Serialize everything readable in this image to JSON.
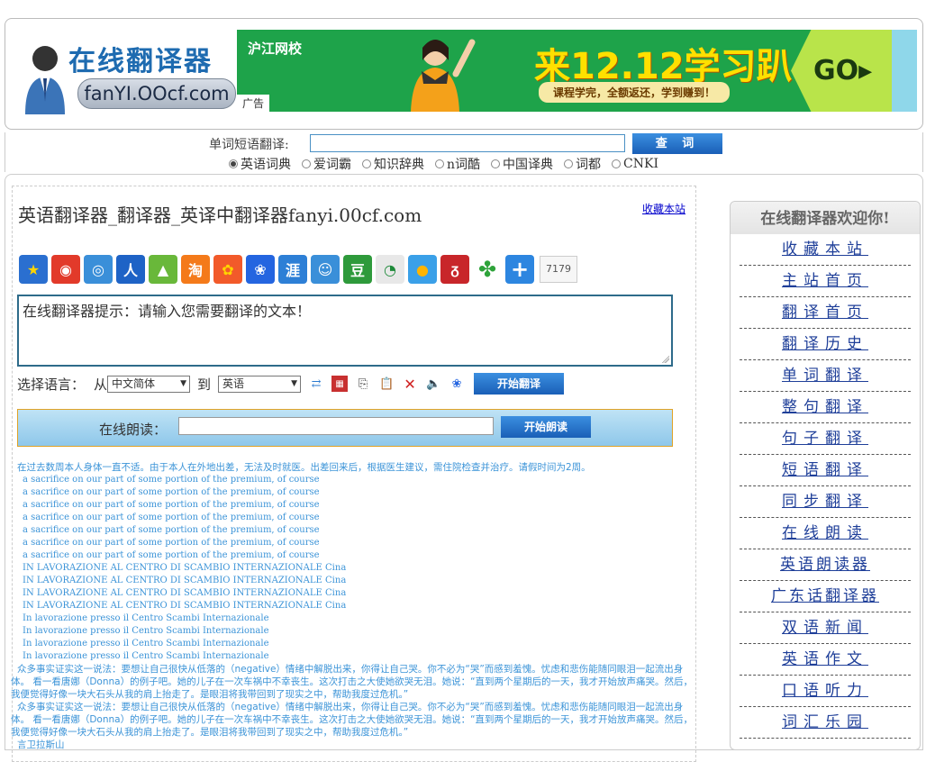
{
  "header": {
    "logo_title": "在线翻译器",
    "logo_domain": "fanYI.OOcf.com",
    "banner": {
      "brand": "沪江网校",
      "ad_label": "广告",
      "title": "来12.12学习趴",
      "subtitle": "课程学完，全额返还，学到赚到！",
      "go": "GO▸"
    }
  },
  "search": {
    "label": "单词短语翻译:",
    "button": "查 词",
    "options": [
      {
        "label": "英语词典",
        "checked": true
      },
      {
        "label": "爱词霸",
        "checked": false
      },
      {
        "label": "知识辞典",
        "checked": false
      },
      {
        "label": "n词酷",
        "checked": false
      },
      {
        "label": "中国译典",
        "checked": false
      },
      {
        "label": "词都",
        "checked": false
      },
      {
        "label": "CNKI",
        "checked": false
      }
    ]
  },
  "main": {
    "title": "英语翻译器_翻译器_英译中翻译器fanyi.00cf.com",
    "bookmark": "收藏本站",
    "share_count": "7179",
    "textarea_text": "在线翻译器提示：请输入您需要翻译的文本！",
    "lang": {
      "label": "选择语言：",
      "from": "从",
      "from_value": "中文简体",
      "to": "到",
      "to_value": "英语",
      "translate_button": "开始翻译"
    },
    "read": {
      "label": "在线朗读：",
      "button": "开始朗读"
    }
  },
  "history": {
    "line_cn": "在过去数周本人身体一直不适。由于本人在外地出差，无法及时就医。出差回来后，根据医生建议，需住院检查并治疗。请假时间为2周。",
    "sacrifice": [
      "a sacrifice on our part of some portion of the premium, of course",
      "a sacrifice on our part of some portion of the premium, of course",
      "a sacrifice on our part of some portion of the premium, of course",
      "a sacrifice on our part of some portion of the premium, of course",
      "a sacrifice on our part of some portion of the premium, of course",
      "a sacrifice on our part of some portion of the premium, of course",
      "a sacrifice on our part of some portion of the premium, of course"
    ],
    "lavorazione_upper": [
      "IN LAVORAZIONE AL CENTRO DI SCAMBIO INTERNAZIONALE Cina",
      "IN LAVORAZIONE AL CENTRO DI SCAMBIO INTERNAZIONALE Cina",
      "IN LAVORAZIONE AL CENTRO DI SCAMBIO INTERNAZIONALE Cina",
      "IN LAVORAZIONE AL CENTRO DI SCAMBIO INTERNAZIONALE Cina"
    ],
    "lavorazione_lower": [
      "In lavorazione presso il Centro Scambi Internazionale",
      "In lavorazione presso il Centro Scambi Internazionale",
      "In lavorazione presso il Centro Scambi Internazionale",
      "In lavorazione presso il Centro Scambi Internazionale"
    ],
    "para1": "众多事实证实这一说法：要想让自己很快从低落的（negative）情绪中解脱出来，你得让自己哭。你不必为“哭”而感到羞愧。忧虑和悲伤能随同眼泪一起流出身体。 看一看唐娜（Donna）的例子吧。她的儿子在一次车祸中不幸丧生。这次打击之大使她欲哭无泪。她说：“直到两个星期后的一天，我才开始放声痛哭。然后，我便觉得好像一块大石头从我的肩上抬走了。是眼泪将我带回到了现实之中，帮助我度过危机。”",
    "para2": "众多事实证实这一说法：要想让自己很快从低落的（negative）情绪中解脱出来，你得让自己哭。你不必为“哭”而感到羞愧。忧虑和悲伤能随同眼泪一起流出身体。 看一看唐娜（Donna）的例子吧。她的儿子在一次车祸中不幸丧生。这次打击之大使她欲哭无泪。她说：“直到两个星期后的一天，我才开始放声痛哭。然后，我便觉得好像一块大石头从我的肩上抬走了。是眼泪将我带回到了现实之中，帮助我度过危机。”",
    "para3": "言卫拉斯山"
  },
  "sidebar": {
    "title": "在线翻译器欢迎你!",
    "items": [
      "收藏本站",
      "主站首页",
      "翻译首页",
      "翻译历史",
      "单词翻译",
      "整句翻译",
      "句子翻译",
      "短语翻译",
      "同步翻译",
      "在线朗读",
      "英语朗读器",
      "广东话翻译器",
      "双语新闻",
      "英语作文",
      "口语听力",
      "词汇乐园"
    ]
  },
  "colors": {
    "accent_blue": "#1a5fb7",
    "history_text": "#3c94d8",
    "sidebar_link": "#1f3f99"
  }
}
